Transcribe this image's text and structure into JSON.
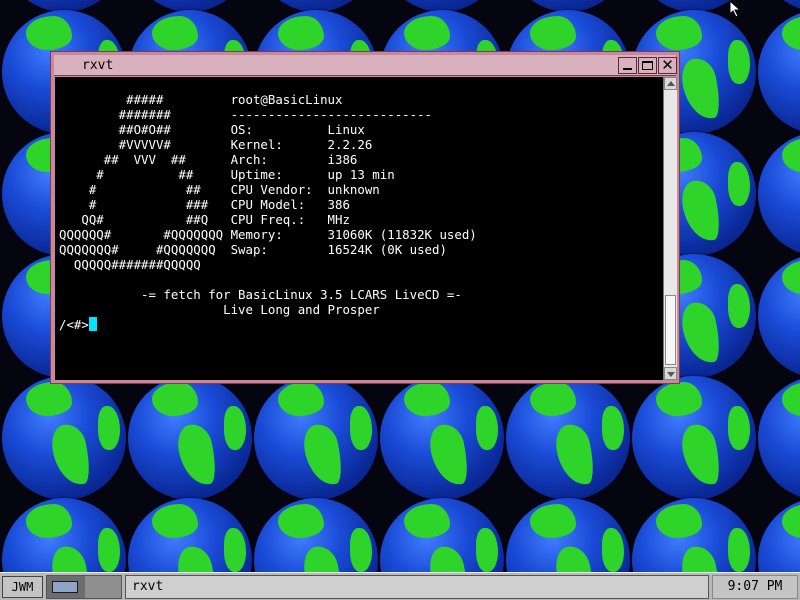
{
  "window": {
    "title": "rxvt",
    "close_glyph": "✕"
  },
  "terminal": {
    "lines": [
      "         #####         root@BasicLinux",
      "        #######        ---------------------------",
      "        ##O#O##        OS:          Linux",
      "        #VVVVV#        Kernel:      2.2.26",
      "      ##  VVV  ##      Arch:        i386",
      "     #          ##     Uptime:      up 13 min",
      "    #            ##    CPU Vendor:  unknown",
      "    #            ###   CPU Model:   386",
      "   QQ#           ##Q   CPU Freq.:   MHz",
      "QQQQQQ#       #QQQQQQQ Memory:      31060K (11832K used)",
      "QQQQQQQ#     #QQQQQQQ  Swap:        16524K (0K used)",
      "  QQQQQ#######QQQQQ",
      "",
      "           -= fetch for BasicLinux 3.5 LCARS LiveCD =-",
      "                      Live Long and Prosper"
    ],
    "prompt": "/<#>"
  },
  "taskbar": {
    "menu_label": "JWM",
    "task_label": "rxvt",
    "clock": "9:07 PM"
  },
  "colors": {
    "window_border": "#c8879a",
    "titlebar": "#d9b0bd",
    "terminal_bg": "#000000",
    "terminal_fg": "#ffffff",
    "cursor": "#00e5ff",
    "taskbar": "#b8b8b8",
    "globe_ocean": "#1a4bd6",
    "globe_land": "#2fd42a"
  },
  "icons": {
    "minimize": "minimize-icon",
    "maximize": "maximize-icon",
    "close": "close-icon",
    "pointer": "mouse-pointer-icon"
  }
}
